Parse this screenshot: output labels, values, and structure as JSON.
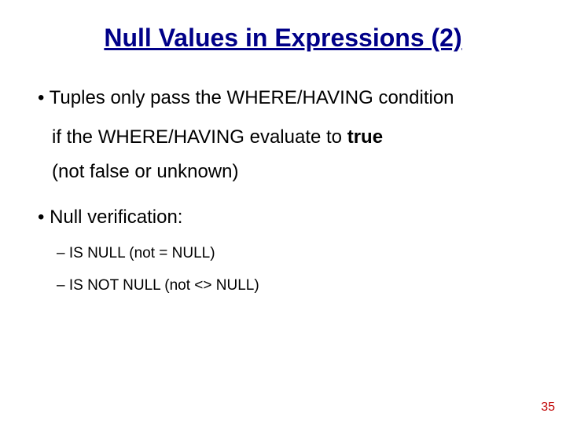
{
  "title": "Null Values in Expressions (2)",
  "bullets": {
    "b1_line1": "Tuples only pass the WHERE/HAVING condition",
    "b1_line2": "if the WHERE/HAVING evaluate to ",
    "b1_true": "true",
    "b1_line3": "(not false or unknown)",
    "b2": "Null verification:",
    "s1": " IS NULL (not = NULL)",
    "s2": " IS NOT NULL (not <> NULL)"
  },
  "page_number": "35"
}
